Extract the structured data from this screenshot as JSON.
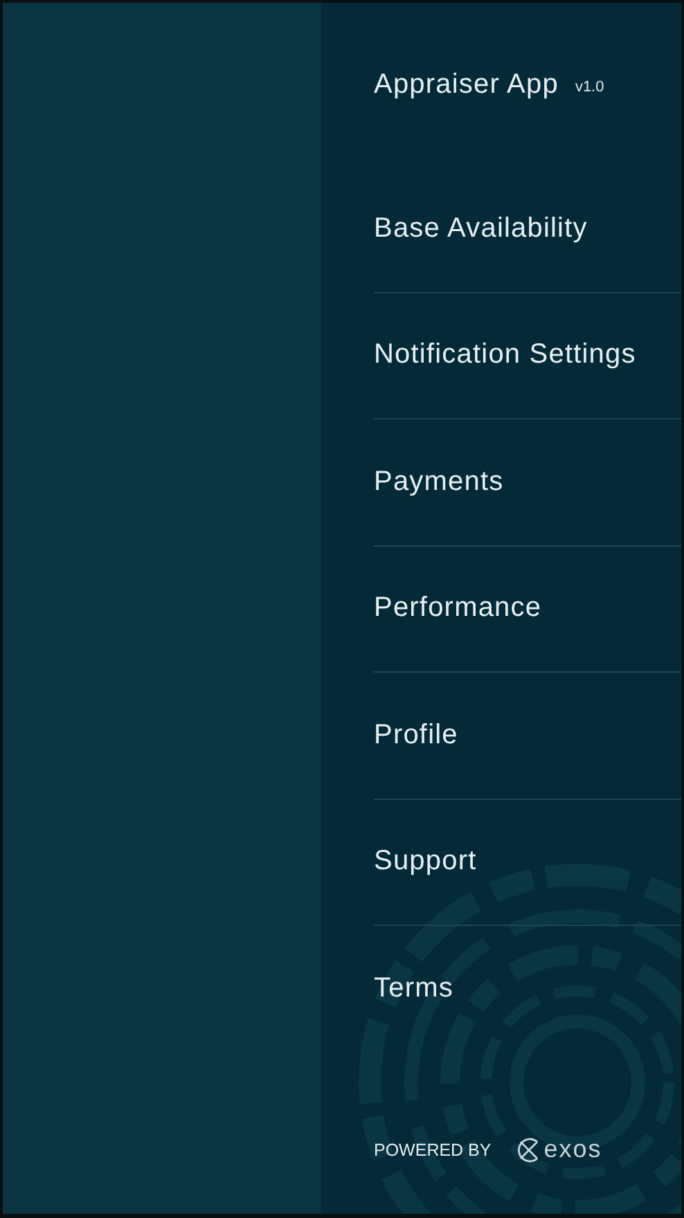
{
  "menu": {
    "title": "Appraiser App",
    "version": "v1.0",
    "items": [
      {
        "label": "Base Availability"
      },
      {
        "label": "Notification Settings"
      },
      {
        "label": "Payments"
      },
      {
        "label": "Performance"
      },
      {
        "label": "Profile"
      },
      {
        "label": "Support"
      },
      {
        "label": "Terms"
      }
    ],
    "footer": {
      "powered_by": "POWERED BY",
      "brand": "exos"
    }
  }
}
